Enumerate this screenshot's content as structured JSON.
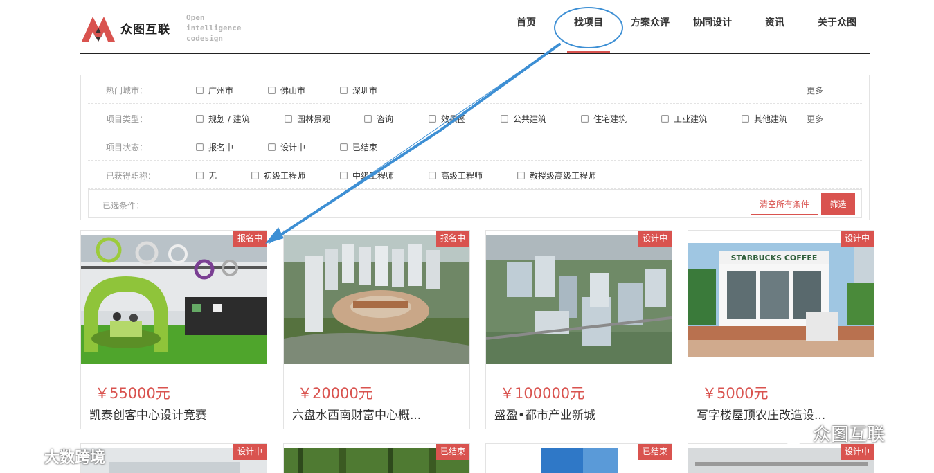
{
  "brand": {
    "name": "众图互联",
    "tagline_lines": [
      "Open",
      "intelligence",
      "codesign"
    ],
    "accent_color": "#d9534f",
    "logo_color": "#d9534f"
  },
  "nav": {
    "items": [
      {
        "label": "首页",
        "active": false
      },
      {
        "label": "找项目",
        "active": true
      },
      {
        "label": "方案众评",
        "active": false
      },
      {
        "label": "协同设计",
        "active": false
      },
      {
        "label": "资讯",
        "active": false
      },
      {
        "label": "关于众图",
        "active": false
      }
    ]
  },
  "filters": {
    "rows": [
      {
        "label": "热门城市：",
        "options": [
          "广州市",
          "佛山市",
          "深圳市"
        ],
        "more": "更多"
      },
      {
        "label": "项目类型：",
        "options": [
          "规划 / 建筑",
          "园林景观",
          "咨询",
          "效果图",
          "公共建筑",
          "住宅建筑",
          "工业建筑",
          "其他建筑"
        ],
        "more": "更多"
      },
      {
        "label": "项目状态：",
        "options": [
          "报名中",
          "设计中",
          "已结束"
        ]
      },
      {
        "label": "已获得职称：",
        "options": [
          "无",
          "初级工程师",
          "中级工程师",
          "高级工程师",
          "教授级高级工程师"
        ]
      }
    ],
    "selected_label": "已选条件：",
    "clear_label": "清空所有条件",
    "submit_label": "筛选"
  },
  "projects": [
    {
      "status": "报名中",
      "price": "￥55000元",
      "title": "凯泰创客中心设计竞赛",
      "image": "office-interior"
    },
    {
      "status": "报名中",
      "price": "￥20000元",
      "title": "六盘水西南财富中心概...",
      "image": "city-aerial"
    },
    {
      "status": "设计中",
      "price": "￥100000元",
      "title": "盛盈•都市产业新城",
      "image": "industrial-park"
    },
    {
      "status": "设计中",
      "price": "￥5000元",
      "title": "写字楼屋顶农庄改造设...",
      "image": "starbucks-cafe"
    },
    {
      "status": "设计中",
      "image": "building"
    },
    {
      "status": "已结束",
      "image": "forest"
    },
    {
      "status": "已结束",
      "image": "glass-tower"
    },
    {
      "status": "设计中",
      "image": "classroom"
    }
  ],
  "cafe_sign": "STARBUCKS COFFEE",
  "watermarks": {
    "left": "大数跨境",
    "right": "众图互联"
  },
  "annotation_color": "#3d8fd4"
}
